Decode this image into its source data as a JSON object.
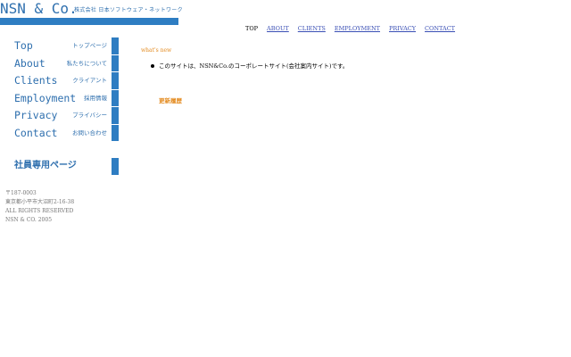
{
  "header": {
    "logo": "NSN & Co.",
    "company": "株式会社 日本ソフトウェア・ネットワーク"
  },
  "topnav": [
    {
      "label": "TOP",
      "current": true
    },
    {
      "label": "ABOUT"
    },
    {
      "label": "CLIENTS"
    },
    {
      "label": "EMPLOYMENT"
    },
    {
      "label": "PRIVACY"
    },
    {
      "label": "CONTACT"
    }
  ],
  "sidenav": [
    {
      "en": "Top",
      "jp": "トップページ"
    },
    {
      "en": "About",
      "jp": "私たちについて"
    },
    {
      "en": "Clients",
      "jp": "クライアント"
    },
    {
      "en": "Employment",
      "jp": "採用情報"
    },
    {
      "en": "Privacy",
      "jp": "プライバシー"
    },
    {
      "en": "Contact",
      "jp": "お問い合わせ"
    }
  ],
  "staff": {
    "label": "社員専用ページ"
  },
  "address": {
    "postal": "〒187-0003",
    "street": "東京都小平市大沼町2-16-38",
    "rights": "ALL RIGHTS RESERVED",
    "copyright": "NSN & CO. 2005"
  },
  "main": {
    "whats_new": "what's new",
    "news": [
      "このサイトは、NSN&Co.のコーポレートサイト(会社案内サイト)です。"
    ],
    "history": "更新履歴"
  },
  "colors": {
    "brand": "#2e7dc2",
    "brand_text": "#2e6fae",
    "accent": "#e38a1e",
    "link": "#3a4fb5"
  }
}
